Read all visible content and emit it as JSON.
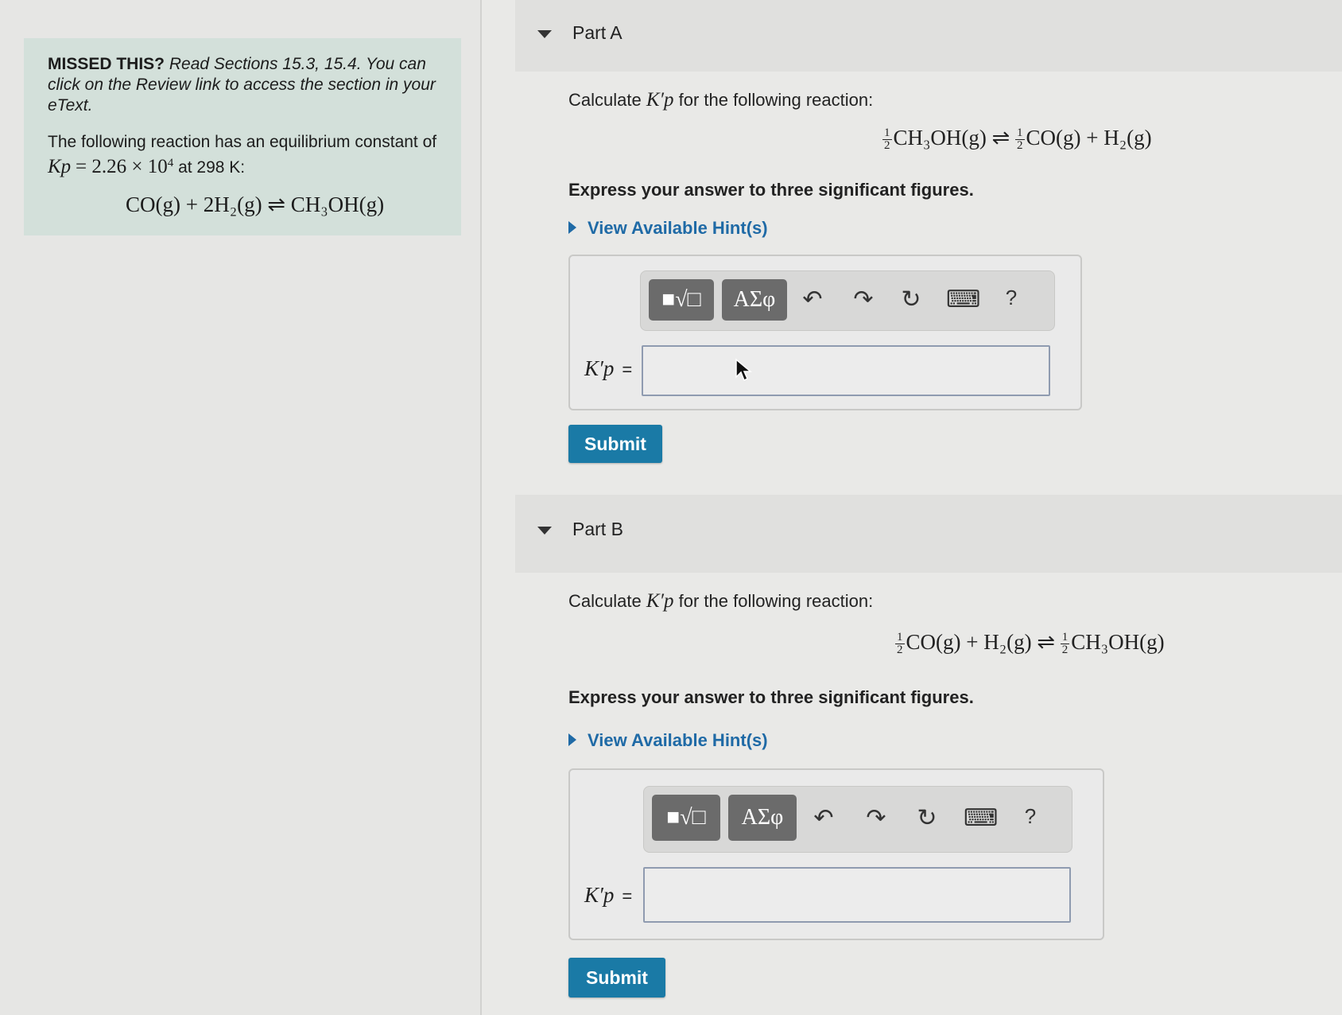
{
  "intro": {
    "missed_label": "MISSED THIS?",
    "missed_text": "Read Sections 15.3, 15.4. You can click on the Review link to access the section in your eText.",
    "reaction_text_1": "The following reaction  has an equilibrium constant of",
    "kp_symbol": "Kp",
    "kp_value": "= 2.26 × 10",
    "kp_exp": "4",
    "at_text": "at 298 K:",
    "equation": "CO(g) + 2H₂(g) ⇌ CH₃OH(g)"
  },
  "partA": {
    "title": "Part A",
    "question_prefix": "Calculate",
    "question_symbol": "K′p",
    "question_suffix": "for the following reaction:",
    "eq_left": "CH₃OH(g) ⇌",
    "eq_mid": "CO(g) + H₂(g)",
    "frac_num": "1",
    "frac_den": "2",
    "express": "Express your answer to three significant figures.",
    "hint": "View Available Hint(s)",
    "answer_label": "K′p",
    "equals": "=",
    "answer_value": "",
    "submit": "Submit"
  },
  "partB": {
    "title": "Part B",
    "question_prefix": "Calculate",
    "question_symbol": "K′p",
    "question_suffix": "for the following reaction:",
    "eq_left": "CO(g) + H₂(g) ⇌",
    "eq_right": "CH₃OH(g)",
    "frac_num": "1",
    "frac_den": "2",
    "express": "Express your answer to three significant figures.",
    "hint": "View Available Hint(s)",
    "answer_label": "K′p",
    "equals": "=",
    "answer_value": "",
    "submit": "Submit"
  },
  "toolbar": {
    "template_icon": "■√□",
    "greek_label": "ΑΣφ",
    "undo": "↶",
    "redo": "↷",
    "reset": "↻",
    "keyboard": "⌨",
    "help": "?"
  },
  "colors": {
    "accent": "#1a7aa6",
    "hint": "#1f6aa6",
    "missed_bg": "#d3e0da"
  }
}
